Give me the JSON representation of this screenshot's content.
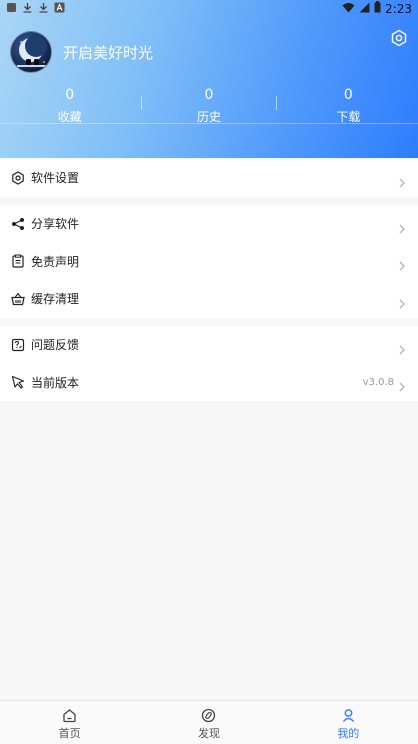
{
  "status_bar": {
    "time": "2:23",
    "left_icons": [
      "app-notification-icon",
      "download-icon",
      "download-icon",
      "a-letter-icon"
    ],
    "right_icons": [
      "wifi-icon",
      "signal-icon",
      "battery-icon"
    ]
  },
  "profile": {
    "nickname": "开启美好时光",
    "settings_icon": "settings-gear-icon"
  },
  "stats": [
    {
      "count": "0",
      "label": "收藏"
    },
    {
      "count": "0",
      "label": "历史"
    },
    {
      "count": "0",
      "label": "下载"
    }
  ],
  "menu": {
    "software_settings": "软件设置",
    "share_software": "分享软件",
    "disclaimer": "免责声明",
    "cache_clean": "缓存清理",
    "feedback": "问题反馈",
    "current_version": "当前版本",
    "version_value": "v3.0.8"
  },
  "tabbar": {
    "home": "首页",
    "discover": "发现",
    "mine": "我的",
    "active": "mine"
  },
  "colors": {
    "accent": "#2f7dfd",
    "header_start": "#a9d6f6",
    "header_end": "#2f7dfd"
  }
}
